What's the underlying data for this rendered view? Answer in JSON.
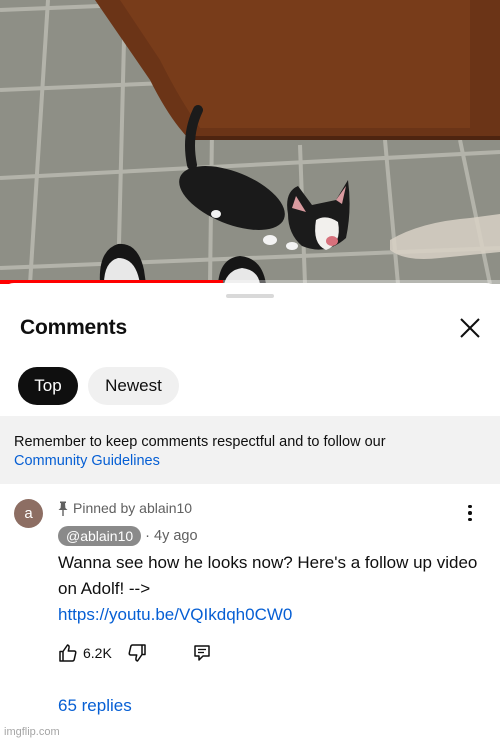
{
  "video": {
    "progress_fraction": 0.445,
    "progress_color": "#ff0000"
  },
  "comments_sheet": {
    "title": "Comments",
    "close_icon": "close-icon",
    "filters": [
      {
        "label": "Top",
        "selected": true
      },
      {
        "label": "Newest",
        "selected": false
      }
    ],
    "notice": {
      "text": "Remember to keep comments respectful and to follow our",
      "link": "Community Guidelines"
    }
  },
  "comment": {
    "avatar_letter": "a",
    "avatar_color": "#8d6e63",
    "pinned_label": "Pinned by ablain10",
    "author": "@ablain10",
    "separator": "·",
    "age": "4y ago",
    "text": "Wanna see how he looks now? Here's a follow up video on Adolf! -->",
    "link": "https://youtu.be/VQIkdqh0CW0",
    "likes": "6.2K",
    "replies_label": "65 replies"
  },
  "colors": {
    "accent_link": "#065fd4",
    "chip_selected_bg": "#0f0f0f",
    "chip_unselected_bg": "#f0f0f0"
  },
  "watermark": "imgflip.com"
}
